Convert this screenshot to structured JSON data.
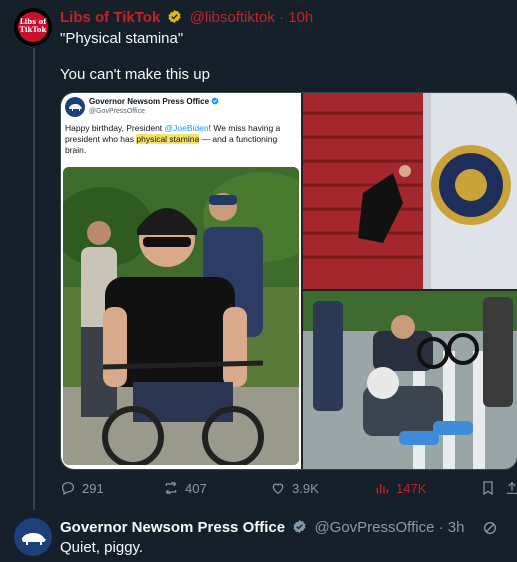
{
  "tweet1": {
    "avatar_text": "Libs of TikTok",
    "name": "Libs of TikTok",
    "handle": "@libsoftiktok",
    "time": "10h",
    "line1": "\"Physical stamina\"",
    "line2": "You can't make this up",
    "embedded": {
      "name": "Governor Newsom Press Office",
      "handle": "@GovPressOffice",
      "text_a": "Happy birthday, President ",
      "mention": "@JoeBiden",
      "text_b": "! We miss having a president who has ",
      "highlight": "physical stamina",
      "text_c": " — and a functioning brain."
    },
    "stats": {
      "replies": "291",
      "reposts": "407",
      "likes": "3.9K",
      "views": "147K"
    }
  },
  "tweet2": {
    "name": "Governor Newsom Press Office",
    "handle": "@GovPressOffice",
    "time": "3h",
    "text": "Quiet, piggy."
  },
  "colors": {
    "accent_red": "#c22228",
    "background": "#15202b",
    "verified_gold": "#e2b719",
    "verified_gray": "#829aab"
  }
}
